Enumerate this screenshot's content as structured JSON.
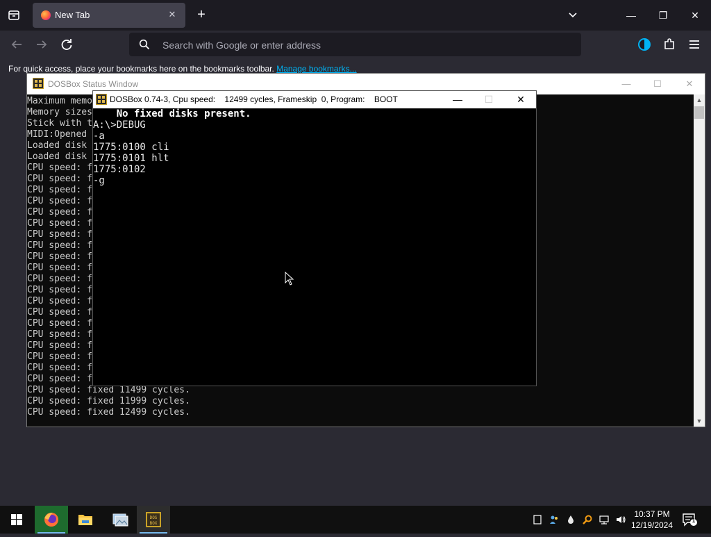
{
  "browser": {
    "tab": {
      "title": "New Tab",
      "close_glyph": "✕"
    },
    "new_tab_glyph": "+",
    "search_placeholder": "Search with Google or enter address",
    "bookmarks_message": "For quick access, place your bookmarks here on the bookmarks toolbar.",
    "manage_bookmarks_link": "Manage bookmarks...",
    "window_controls": {
      "minimize": "—",
      "restore": "❐",
      "close": "✕"
    }
  },
  "status_window": {
    "title": "DOSBox Status Window",
    "controls": {
      "minimize": "—",
      "maximize": "☐",
      "close": "✕"
    },
    "lines": [
      "Maximum memo",
      "Memory sizes",
      "Stick with t",
      "MIDI:Opened",
      "Loaded disk",
      "Loaded disk",
      "CPU speed: f",
      "CPU speed: f",
      "CPU speed: f",
      "CPU speed: f",
      "CPU speed: f",
      "CPU speed: f",
      "CPU speed: f",
      "CPU speed: f",
      "CPU speed: f",
      "CPU speed: f",
      "CPU speed: f",
      "CPU speed: f",
      "CPU speed: f",
      "CPU speed: f",
      "CPU speed: f",
      "CPU speed: f",
      "CPU speed: f",
      "CPU speed: f",
      "CPU speed: f",
      "CPU speed: f",
      "CPU speed: fixed 11499 cycles.",
      "CPU speed: fixed 11999 cycles.",
      "CPU speed: fixed 12499 cycles."
    ]
  },
  "dosbox": {
    "title": "DOSBox 0.74-3, Cpu speed:    12499 cycles, Frameskip  0, Program:    BOOT",
    "controls": {
      "minimize": "—",
      "maximize": "☐",
      "close": "✕"
    },
    "screen_lines": [
      "    No fixed disks present.",
      "A:\\>DEBUG",
      "-a",
      "1775:0100 cli",
      "1775:0101 hlt",
      "1775:0102",
      "-g"
    ]
  },
  "taskbar": {
    "apps": [
      "firefox-icon",
      "file-explorer-icon",
      "photos-icon",
      "dosbox-icon"
    ],
    "time": "10:37 PM",
    "date": "12/19/2024",
    "notification_count": "1"
  }
}
